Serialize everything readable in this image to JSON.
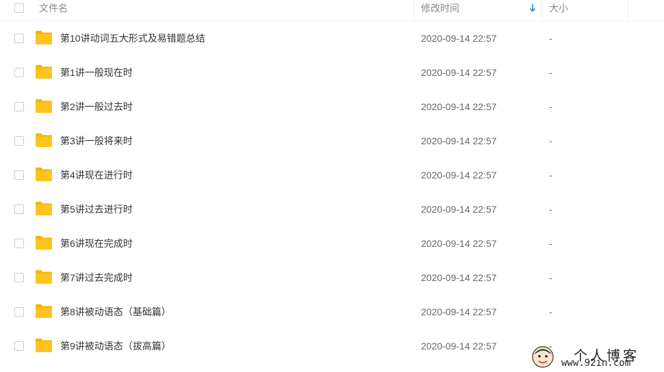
{
  "header": {
    "name_label": "文件名",
    "time_label": "修改时间",
    "size_label": "大小",
    "sort_icon": "arrow-down-icon"
  },
  "files": [
    {
      "name": "第10讲动词五大形式及易错题总结",
      "modified": "2020-09-14 22:57",
      "size": "-",
      "icon": "folder-icon"
    },
    {
      "name": "第1讲一般现在时",
      "modified": "2020-09-14 22:57",
      "size": "-",
      "icon": "folder-icon"
    },
    {
      "name": "第2讲一般过去时",
      "modified": "2020-09-14 22:57",
      "size": "-",
      "icon": "folder-icon"
    },
    {
      "name": "第3讲一般将来时",
      "modified": "2020-09-14 22:57",
      "size": "-",
      "icon": "folder-icon"
    },
    {
      "name": "第4讲现在进行时",
      "modified": "2020-09-14 22:57",
      "size": "-",
      "icon": "folder-icon"
    },
    {
      "name": "第5讲过去进行时",
      "modified": "2020-09-14 22:57",
      "size": "-",
      "icon": "folder-icon"
    },
    {
      "name": "第6讲现在完成时",
      "modified": "2020-09-14 22:57",
      "size": "-",
      "icon": "folder-icon"
    },
    {
      "name": "第7讲过去完成时",
      "modified": "2020-09-14 22:57",
      "size": "-",
      "icon": "folder-icon"
    },
    {
      "name": "第8讲被动语态（基础篇）",
      "modified": "2020-09-14 22:57",
      "size": "-",
      "icon": "folder-icon"
    },
    {
      "name": "第9讲被动语态（拔高篇）",
      "modified": "2020-09-14 22:57",
      "size": "-",
      "icon": "folder-icon"
    }
  ],
  "watermark": {
    "title": "个人博客",
    "url": "www.92in.com"
  },
  "colors": {
    "folder": "#FFC41F",
    "folder_back": "#F7B500",
    "sort_arrow": "#3A8EE6",
    "divider": "#F0F1F4"
  }
}
